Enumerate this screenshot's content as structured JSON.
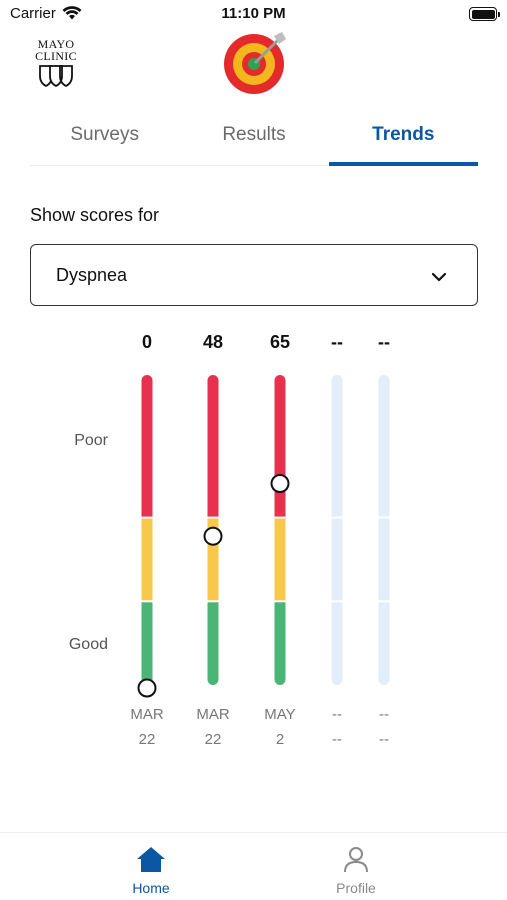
{
  "status_bar": {
    "carrier": "Carrier",
    "time": "11:10 PM"
  },
  "header": {
    "logo_line1": "MAYO",
    "logo_line2": "CLINIC"
  },
  "tabs": [
    {
      "label": "Surveys",
      "active": false
    },
    {
      "label": "Results",
      "active": false
    },
    {
      "label": "Trends",
      "active": true
    }
  ],
  "show_scores_label": "Show scores for",
  "selector": {
    "value": "Dyspnea"
  },
  "chart_data": {
    "type": "range-bars",
    "y_labels": {
      "top": "Poor",
      "bottom": "Good"
    },
    "y_range": [
      0,
      100
    ],
    "zones": [
      {
        "name": "good",
        "from": 0,
        "to": 27,
        "color": "#4bb577"
      },
      {
        "name": "moderate",
        "from": 27,
        "to": 54,
        "color": "#f7c84a"
      },
      {
        "name": "poor",
        "from": 54,
        "to": 100,
        "color": "#e8304f"
      }
    ],
    "placeholder_color": "#e3eefb",
    "entries": [
      {
        "score": "0",
        "value": 0,
        "date_line1": "MAR",
        "date_line2": "22"
      },
      {
        "score": "48",
        "value": 48,
        "date_line1": "MAR",
        "date_line2": "22"
      },
      {
        "score": "65",
        "value": 65,
        "date_line1": "MAY",
        "date_line2": "2"
      },
      {
        "score": "--",
        "value": null,
        "date_line1": "--",
        "date_line2": "--"
      },
      {
        "score": "--",
        "value": null,
        "date_line1": "--",
        "date_line2": "--"
      }
    ]
  },
  "bottom_nav": {
    "home": {
      "label": "Home",
      "icon": "home-icon"
    },
    "profile": {
      "label": "Profile",
      "icon": "person-icon"
    }
  },
  "colors": {
    "accent": "#0b57a4",
    "inactive": "#8a8a8a"
  }
}
